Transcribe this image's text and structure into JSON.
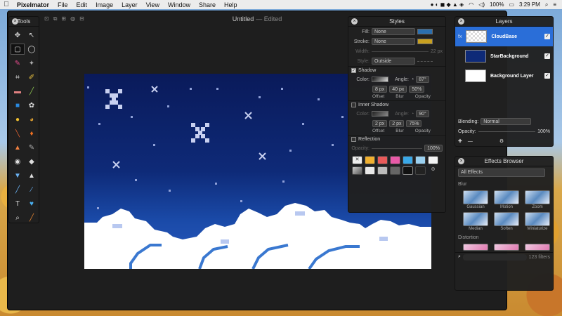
{
  "menubar": {
    "app_name": "Pixelmator",
    "items": [
      "File",
      "Edit",
      "Image",
      "Layer",
      "View",
      "Window",
      "Share",
      "Help"
    ],
    "battery": "100%",
    "time": "3:29 PM"
  },
  "window": {
    "title": "Untitled",
    "status": "— Edited"
  },
  "tools": {
    "title": "Tools"
  },
  "styles": {
    "title": "Styles",
    "fill_label": "Fill:",
    "fill_value": "None",
    "stroke_label": "Stroke:",
    "stroke_value": "None",
    "width_label": "Width:",
    "width_value": "22 px",
    "style_label": "Style:",
    "style_value": "Outside",
    "shadow_label": "Shadow",
    "color_label": "Color:",
    "angle_label": "Angle:",
    "shadow_angle": "87°",
    "shadow_offset": "8 px",
    "shadow_blur": "40 px",
    "shadow_opacity": "50%",
    "offset_label": "Offset",
    "blur_label": "Blur",
    "opacity_label": "Opacity",
    "inner_shadow_label": "Inner Shadow",
    "inner_angle": "90°",
    "inner_offset": "2 px",
    "inner_blur": "2 px",
    "inner_opacity": "75%",
    "reflection_label": "Reflection",
    "reflection_opacity_label": "Opacity:",
    "reflection_opacity": "100%",
    "fill_color": "#2a6fb0",
    "stroke_color": "#c8a020"
  },
  "layers": {
    "title": "Layers",
    "items": [
      {
        "name": "CloudBase",
        "selected": true
      },
      {
        "name": "StarBackground",
        "selected": false
      },
      {
        "name": "Background Layer",
        "selected": false
      }
    ],
    "blending_label": "Blending:",
    "blending_value": "Normal",
    "opacity_label": "Opacity:",
    "opacity_value": "100%"
  },
  "effects": {
    "title": "Effects Browser",
    "category": "All Effects",
    "blur_section": "Blur",
    "blur_items": [
      "Gaussian",
      "Motion",
      "Zoom",
      "Median",
      "Soften",
      "Miniaturize"
    ],
    "distortion_section": "Distortion",
    "filter_count": "123 filters"
  },
  "colors": {
    "accent": "#2a6ed8",
    "panel": "#202020",
    "sky_top": "#0a1a5a",
    "cloud": "#ffffff",
    "cloud_edge": "#3a78d0"
  }
}
